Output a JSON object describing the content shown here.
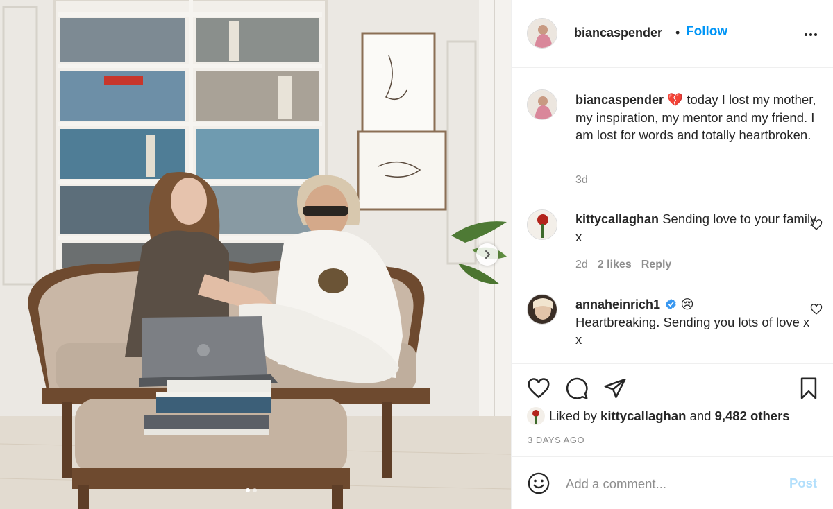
{
  "post": {
    "author": "biancaspender",
    "separator": "•",
    "follow_label": "Follow",
    "more_icon": "more-horizontal-icon"
  },
  "caption": {
    "username": "biancaspender",
    "emoji": "💔",
    "text": "today I lost my mother, my inspiration, my mentor and my friend. I am lost for words and totally heartbroken.",
    "age": "3d"
  },
  "comments": [
    {
      "username": "kittycallaghan",
      "text": "Sending love to your family x",
      "age": "2d",
      "likes": "2 likes",
      "reply_label": "Reply"
    },
    {
      "username": "annaheinrich1",
      "verified": true,
      "emoji": "😢",
      "text": "Heartbreaking. Sending you lots of love x x",
      "age": "",
      "likes": "",
      "reply_label": ""
    }
  ],
  "likes": {
    "prefix": "Liked by",
    "user": "kittycallaghan",
    "middle": "and",
    "others": "9,482 others"
  },
  "timestamp": "3 DAYS AGO",
  "add_comment": {
    "placeholder": "Add a comment...",
    "post_label": "Post"
  },
  "carousel": {
    "count": 2,
    "active_index": 0
  },
  "colors": {
    "link": "#0095f6",
    "post_disabled": "#b2dffc",
    "secondary_text": "#8e8e8e",
    "verified": "#3897f0"
  }
}
